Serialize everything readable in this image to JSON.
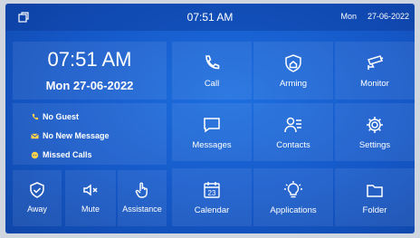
{
  "topbar": {
    "time": "07:51 AM",
    "day": "Mon",
    "date": "27-06-2022"
  },
  "clock": {
    "time": "07:51 AM",
    "date": "Mon 27-06-2022"
  },
  "status": {
    "guest": "No Guest",
    "message": "No New Message",
    "missed": "Missed Calls"
  },
  "quick": {
    "away": "Away",
    "mute": "Mute",
    "assistance": "Assistance"
  },
  "apps": {
    "call": "Call",
    "arming": "Arming",
    "monitor": "Monitor",
    "messages": "Messages",
    "contacts": "Contacts",
    "settings": "Settings",
    "calendar": "Calendar",
    "calendar_day": "23",
    "applications": "Applications",
    "folder": "Folder"
  },
  "icons": {
    "top_left": "window-icon",
    "call": "phone-icon",
    "arming": "shield-house-icon",
    "monitor": "camera-icon",
    "messages": "message-icon",
    "contacts": "contacts-icon",
    "settings": "gear-icon",
    "calendar": "calendar-icon",
    "applications": "lightbulb-icon",
    "folder": "folder-icon",
    "away": "shield-check-icon",
    "mute": "speaker-mute-icon",
    "assistance": "hand-icon"
  },
  "colors": {
    "background": "#1558c8",
    "text": "#ffffff"
  }
}
